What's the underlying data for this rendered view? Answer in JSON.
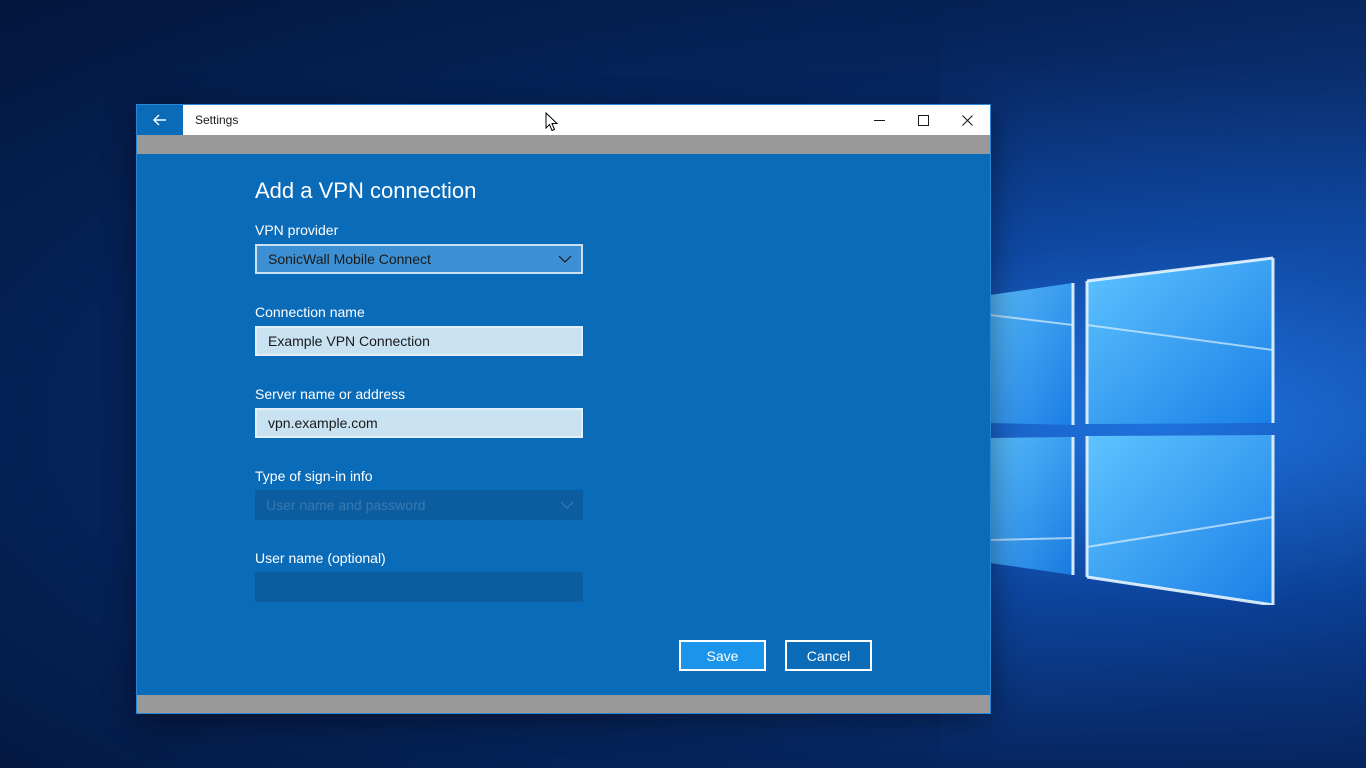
{
  "window": {
    "title": "Settings"
  },
  "form": {
    "heading": "Add a VPN connection",
    "vpn_provider": {
      "label": "VPN provider",
      "value": "SonicWall Mobile Connect"
    },
    "connection_name": {
      "label": "Connection name",
      "value": "Example VPN Connection"
    },
    "server": {
      "label": "Server name or address",
      "value": "vpn.example.com"
    },
    "sign_in_type": {
      "label": "Type of sign-in info",
      "value": "User name and password"
    },
    "username": {
      "label": "User name (optional)",
      "value": ""
    },
    "save_label": "Save",
    "cancel_label": "Cancel"
  },
  "icons": {
    "back": "back-arrow-icon",
    "minimize": "minimize-icon",
    "maximize": "maximize-icon",
    "close": "close-icon",
    "dropdown": "chevron-down-icon"
  },
  "colors": {
    "accent": "#0a6bb8",
    "save_button": "#1b95ec",
    "textbox_fill": "#c8e2f2"
  }
}
